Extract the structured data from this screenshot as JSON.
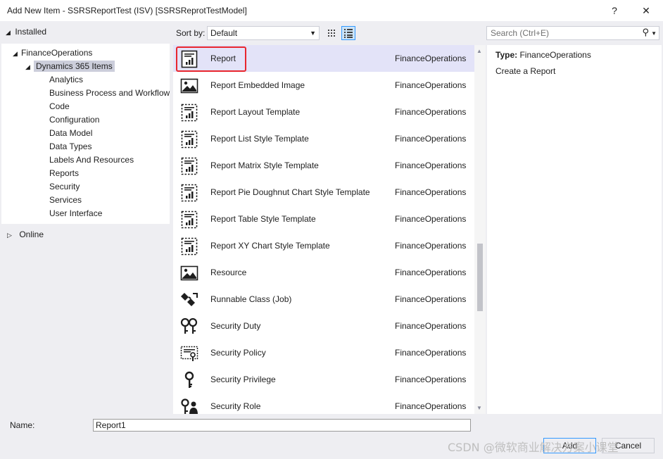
{
  "window": {
    "title": "Add New Item - SSRSReportTest (ISV) [SSRSReprotTestModel]",
    "help_label": "?",
    "close_label": "✕"
  },
  "tree": {
    "installed_label": "Installed",
    "root_label": "FinanceOperations",
    "group_label": "Dynamics 365 Items",
    "children": [
      "Analytics",
      "Business Process and Workflow",
      "Code",
      "Configuration",
      "Data Model",
      "Data Types",
      "Labels And Resources",
      "Reports",
      "Security",
      "Services",
      "User Interface"
    ],
    "online_label": "Online"
  },
  "toolbar": {
    "sort_label": "Sort by:",
    "sort_value": "Default"
  },
  "search": {
    "placeholder": "Search (Ctrl+E)"
  },
  "items": [
    {
      "name": "Report",
      "lang": "FinanceOperations",
      "icon": "report-icon"
    },
    {
      "name": "Report Embedded Image",
      "lang": "FinanceOperations",
      "icon": "image-icon"
    },
    {
      "name": "Report Layout Template",
      "lang": "FinanceOperations",
      "icon": "report-template-icon"
    },
    {
      "name": "Report List Style Template",
      "lang": "FinanceOperations",
      "icon": "report-template-icon"
    },
    {
      "name": "Report Matrix Style Template",
      "lang": "FinanceOperations",
      "icon": "report-template-icon"
    },
    {
      "name": "Report Pie Doughnut Chart Style Template",
      "lang": "FinanceOperations",
      "icon": "report-template-icon"
    },
    {
      "name": "Report Table Style Template",
      "lang": "FinanceOperations",
      "icon": "report-template-icon"
    },
    {
      "name": "Report XY Chart Style Template",
      "lang": "FinanceOperations",
      "icon": "report-template-icon"
    },
    {
      "name": "Resource",
      "lang": "FinanceOperations",
      "icon": "image-icon"
    },
    {
      "name": "Runnable Class (Job)",
      "lang": "FinanceOperations",
      "icon": "runnable-class-icon"
    },
    {
      "name": "Security Duty",
      "lang": "FinanceOperations",
      "icon": "security-duty-icon"
    },
    {
      "name": "Security Policy",
      "lang": "FinanceOperations",
      "icon": "security-policy-icon"
    },
    {
      "name": "Security Privilege",
      "lang": "FinanceOperations",
      "icon": "key-icon"
    },
    {
      "name": "Security Role",
      "lang": "FinanceOperations",
      "icon": "security-role-icon"
    }
  ],
  "details": {
    "type_key": "Type:",
    "type_value": "FinanceOperations",
    "description": "Create a Report"
  },
  "footer": {
    "name_label": "Name:",
    "name_value": "Report1",
    "add_label": "Add",
    "cancel_label": "Cancel",
    "watermark": "CSDN @微软商业解决方案小课堂"
  },
  "colors": {
    "selected_row": "#e3e3f8",
    "highlight_border": "#e8262e",
    "tree_selected": "#cccedb"
  }
}
